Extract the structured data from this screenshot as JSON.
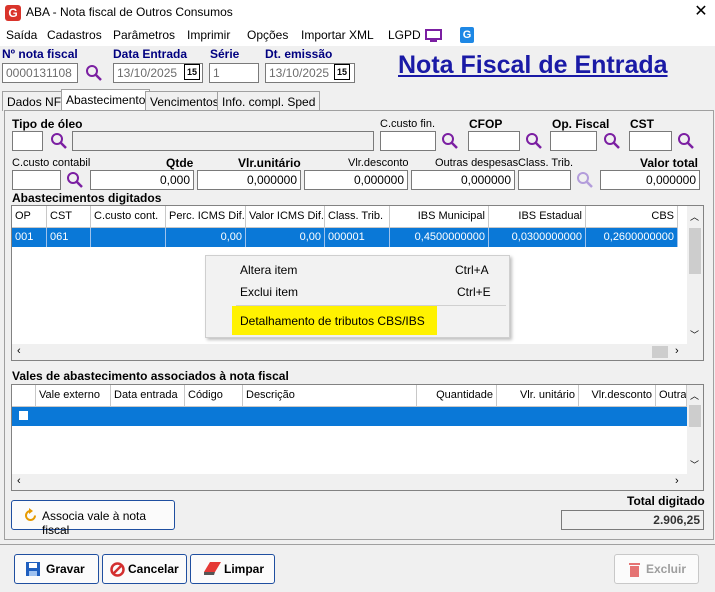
{
  "window": {
    "title": "ABA - Nota fiscal de Outros Consumos",
    "close": "✕"
  },
  "menu": [
    "Saída",
    "Cadastros",
    "Parâmetros",
    "Imprimir",
    "Opções",
    "Importar XML",
    "LGPD"
  ],
  "header": {
    "nota_label": "Nº nota fiscal",
    "nota_value": "0000131108",
    "data_entrada_label": "Data Entrada",
    "data_entrada_value": "13/10/2025",
    "serie_label": "Série",
    "serie_value": "1",
    "dt_emissao_label": "Dt. emissão",
    "dt_emissao_value": "13/10/2025",
    "calendar_glyph": "15",
    "page_title": "Nota Fiscal de Entrada"
  },
  "tabs": [
    "Dados NF",
    "Abastecimento",
    "Vencimentos",
    "Info. compl. Sped"
  ],
  "form": {
    "tipo_oleo_label": "Tipo de óleo",
    "ccusto_fin_label": "C.custo fin.",
    "cfop_label": "CFOP",
    "op_fiscal_label": "Op. Fiscal",
    "cst_label": "CST",
    "ccusto_contabil_label": "C.custo contabil",
    "qtde_label": "Qtde",
    "qtde_value": "0,000",
    "vlr_unitario_label": "Vlr.unitário",
    "vlr_unitario_value": "0,000000",
    "vlr_desconto_label": "Vlr.desconto",
    "vlr_desconto_value": "0,000000",
    "outras_despesas_label": "Outras despesas",
    "outras_despesas_value": "0,000000",
    "class_trib_label": "Class. Trib.",
    "valor_total_label": "Valor total",
    "valor_total_value": "0,000000"
  },
  "abastecimentos": {
    "title": "Abastecimentos digitados",
    "columns": [
      "OP",
      "CST",
      "C.custo cont.",
      "Perc. ICMS Dif.",
      "Valor ICMS Dif.",
      "Class. Trib.",
      "IBS Municipal",
      "IBS Estadual",
      "CBS"
    ],
    "rows": [
      [
        "001",
        "061",
        "",
        "0,00",
        "0,00",
        "000001",
        "0,4500000000",
        "0,0300000000",
        "0,2600000000"
      ]
    ]
  },
  "context_menu": [
    {
      "label": "Altera item",
      "shortcut": "Ctrl+A"
    },
    {
      "label": "Exclui item",
      "shortcut": "Ctrl+E"
    },
    {
      "label": "Detalhamento de tributos CBS/IBS",
      "shortcut": ""
    }
  ],
  "vales": {
    "title": "Vales de abastecimento associados à nota fiscal",
    "columns": [
      "Vale externo",
      "Data entrada",
      "Código",
      "Descrição",
      "Quantidade",
      "Vlr. unitário",
      "Vlr.desconto",
      "Outras"
    ]
  },
  "associa_button": "Associa vale à nota fiscal",
  "total": {
    "label": "Total digitado",
    "value": "2.906,25"
  },
  "buttons": {
    "gravar": "Gravar",
    "cancelar": "Cancelar",
    "limpar": "Limpar",
    "excluir": "Excluir"
  },
  "colors": {
    "selection": "#0a78d7",
    "title_blue": "#1a1aa6",
    "highlight": "#fff200",
    "magnifier": "#7b1fa2"
  }
}
